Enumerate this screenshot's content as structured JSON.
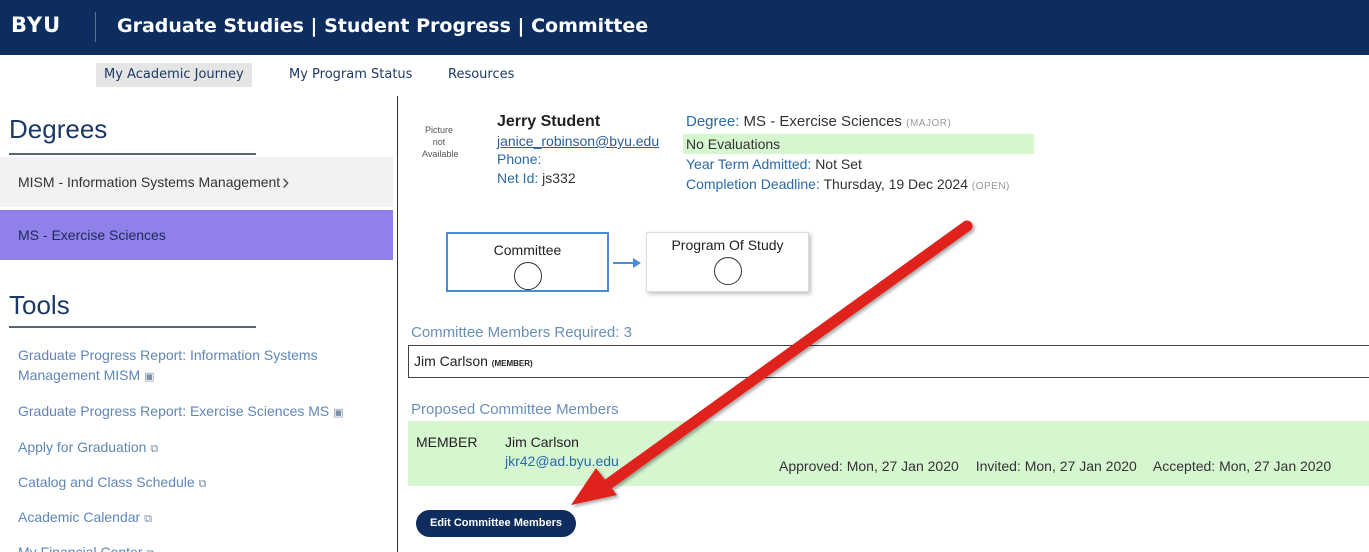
{
  "header": {
    "brand": "BYU",
    "title": "Graduate Studies | Student Progress | Committee"
  },
  "nav": {
    "items": [
      {
        "label": "My Academic Journey",
        "active": true
      },
      {
        "label": "My Program Status",
        "active": false
      },
      {
        "label": "Resources",
        "active": false
      }
    ]
  },
  "sidebar": {
    "degrees_heading": "Degrees",
    "degrees": [
      {
        "label": "MISM - Information Systems Management",
        "selected": false
      },
      {
        "label": "MS - Exercise Sciences",
        "selected": true
      }
    ],
    "tools_heading": "Tools",
    "tools": [
      {
        "label": "Graduate Progress Report: Information Systems Management MISM",
        "icon": "pdf-icon"
      },
      {
        "label": "Graduate Progress Report: Exercise Sciences MS",
        "icon": "pdf-icon"
      },
      {
        "label": "Apply for Graduation",
        "icon": "external-link-icon"
      },
      {
        "label": "Catalog and Class Schedule",
        "icon": "external-link-icon"
      },
      {
        "label": "Academic Calendar",
        "icon": "external-link-icon"
      },
      {
        "label": "My Financial Center",
        "icon": "external-link-icon"
      }
    ]
  },
  "student": {
    "picture_text": "Picture not Available",
    "name": "Jerry Student",
    "email": "janice_robinson@byu.edu",
    "phone_label": "Phone:",
    "netid_label": "Net Id:",
    "netid": "js332",
    "degree_label": "Degree:",
    "degree": "MS - Exercise Sciences",
    "degree_type": "(MAJOR)",
    "evaluations": "No Evaluations",
    "year_term_label": "Year Term Admitted:",
    "year_term": "Not Set",
    "deadline_label": "Completion Deadline:",
    "deadline": "Thursday, 19 Dec 2024",
    "deadline_status": "(OPEN)"
  },
  "steps": [
    {
      "label": "Committee",
      "active": true
    },
    {
      "label": "Program Of Study",
      "active": false
    }
  ],
  "committee": {
    "required_label": "Committee Members Required: 3",
    "member_name": "Jim Carlson",
    "member_role": "(MEMBER)",
    "proposed_heading": "Proposed Committee Members",
    "proposed": [
      {
        "role": "MEMBER",
        "name": "Jim Carlson",
        "email": "jkr42@ad.byu.edu",
        "approved": "Approved: Mon, 27 Jan 2020",
        "invited": "Invited: Mon, 27 Jan 2020",
        "accepted": "Accepted: Mon, 27 Jan 2020"
      }
    ],
    "edit_button": "Edit Committee Members"
  },
  "colors": {
    "brand_navy": "#0d2d5e",
    "selected_purple": "#8f80ea",
    "success_green": "#d6f6d0",
    "annotation_red": "#e0231e"
  }
}
